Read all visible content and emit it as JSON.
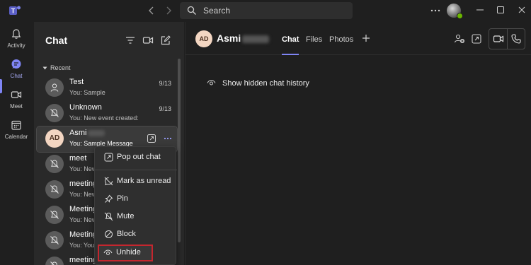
{
  "titlebar": {
    "search_placeholder": "Search",
    "icons": [
      "teams-logo",
      "back-arrow",
      "forward-arrow",
      "search-icon",
      "more-options-icon",
      "avatar",
      "minimize-icon",
      "maximize-icon",
      "close-icon"
    ]
  },
  "rail": {
    "items": [
      {
        "label": "Activity",
        "icon": "bell-icon"
      },
      {
        "label": "Chat",
        "icon": "chat-icon",
        "active": true
      },
      {
        "label": "Meet",
        "icon": "video-icon"
      },
      {
        "label": "Calendar",
        "icon": "calendar-icon"
      }
    ]
  },
  "list": {
    "title": "Chat",
    "section": "Recent",
    "chats": [
      {
        "name": "Test",
        "preview": "You: Sample",
        "date": "9/13",
        "avatar": "person-icon"
      },
      {
        "name": "Unknown",
        "preview": "You: New event created:",
        "date": "9/13",
        "avatar": "muted-bell-icon"
      },
      {
        "name": "Asmi",
        "preview": "You: Sample Message",
        "date": "",
        "avatar_initials": "AD",
        "selected": true
      },
      {
        "name": "meet",
        "preview": "You: New",
        "date": "",
        "avatar": "muted-bell-icon"
      },
      {
        "name": "meeting",
        "preview": "You: New",
        "date": "",
        "avatar": "muted-bell-icon"
      },
      {
        "name": "Meeting",
        "preview": "You: New",
        "date": "",
        "avatar": "muted-bell-icon"
      },
      {
        "name": "Meeting",
        "preview": "You: Your",
        "date": "",
        "avatar": "muted-bell-icon"
      },
      {
        "name": "meeting",
        "preview": "",
        "date": "",
        "avatar": "muted-bell-icon"
      }
    ]
  },
  "menu": {
    "items": [
      {
        "label": "Pop out chat",
        "icon": "pop-out-icon"
      },
      {
        "label": "Mark as unread",
        "icon": "unread-icon"
      },
      {
        "label": "Pin",
        "icon": "pin-icon"
      },
      {
        "label": "Mute",
        "icon": "mute-icon"
      },
      {
        "label": "Block",
        "icon": "block-icon"
      },
      {
        "label": "Unhide",
        "icon": "eye-icon",
        "highlighted": true
      }
    ]
  },
  "main": {
    "avatar_initials": "AD",
    "name": "Asmi",
    "tabs": [
      "Chat",
      "Files",
      "Photos"
    ],
    "active_tab": "Chat",
    "show_hidden_label": "Show hidden chat history"
  },
  "colors": {
    "accent": "#7f85f5",
    "highlight_border": "#c4262e",
    "presence": "#6bb700"
  }
}
